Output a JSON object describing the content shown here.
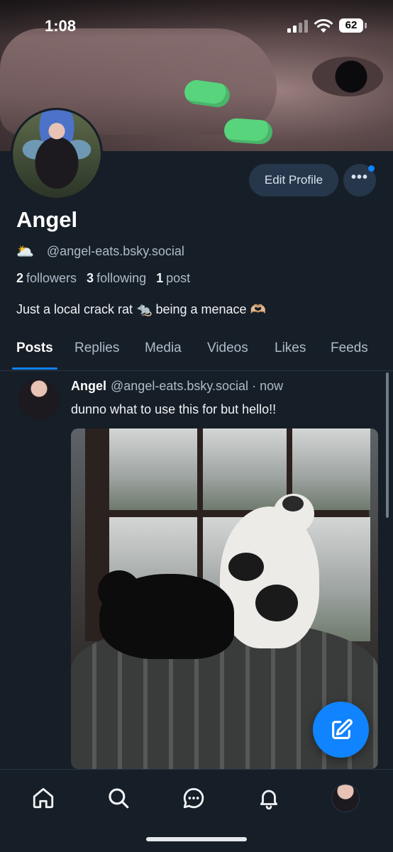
{
  "status_bar": {
    "time": "1:08",
    "battery": "62"
  },
  "profile": {
    "name": "Angel",
    "pronoun_emoji": "🌥️",
    "handle": "@angel-eats.bsky.social",
    "followers_count": "2",
    "followers_label": "followers",
    "following_count": "3",
    "following_label": "following",
    "posts_count": "1",
    "posts_label": "post",
    "bio": "Just a local crack rat 🐀 being a menace 🫶🏼",
    "edit_label": "Edit Profile",
    "more_label": "•••"
  },
  "tabs": [
    {
      "label": "Posts"
    },
    {
      "label": "Replies"
    },
    {
      "label": "Media"
    },
    {
      "label": "Videos"
    },
    {
      "label": "Likes"
    },
    {
      "label": "Feeds"
    }
  ],
  "post": {
    "author": "Angel",
    "handle": "@angel-eats.bsky.social",
    "separator": "·",
    "time": "now",
    "text": "dunno what to use this for but hello!!"
  },
  "bottom_nav": [
    "home-icon",
    "search-icon",
    "chat-icon",
    "bell-icon",
    "profile-avatar"
  ],
  "colors": {
    "background": "#161e27",
    "accent": "#1083fe",
    "button_bg": "#26364b",
    "muted_text": "#aebbc9"
  }
}
